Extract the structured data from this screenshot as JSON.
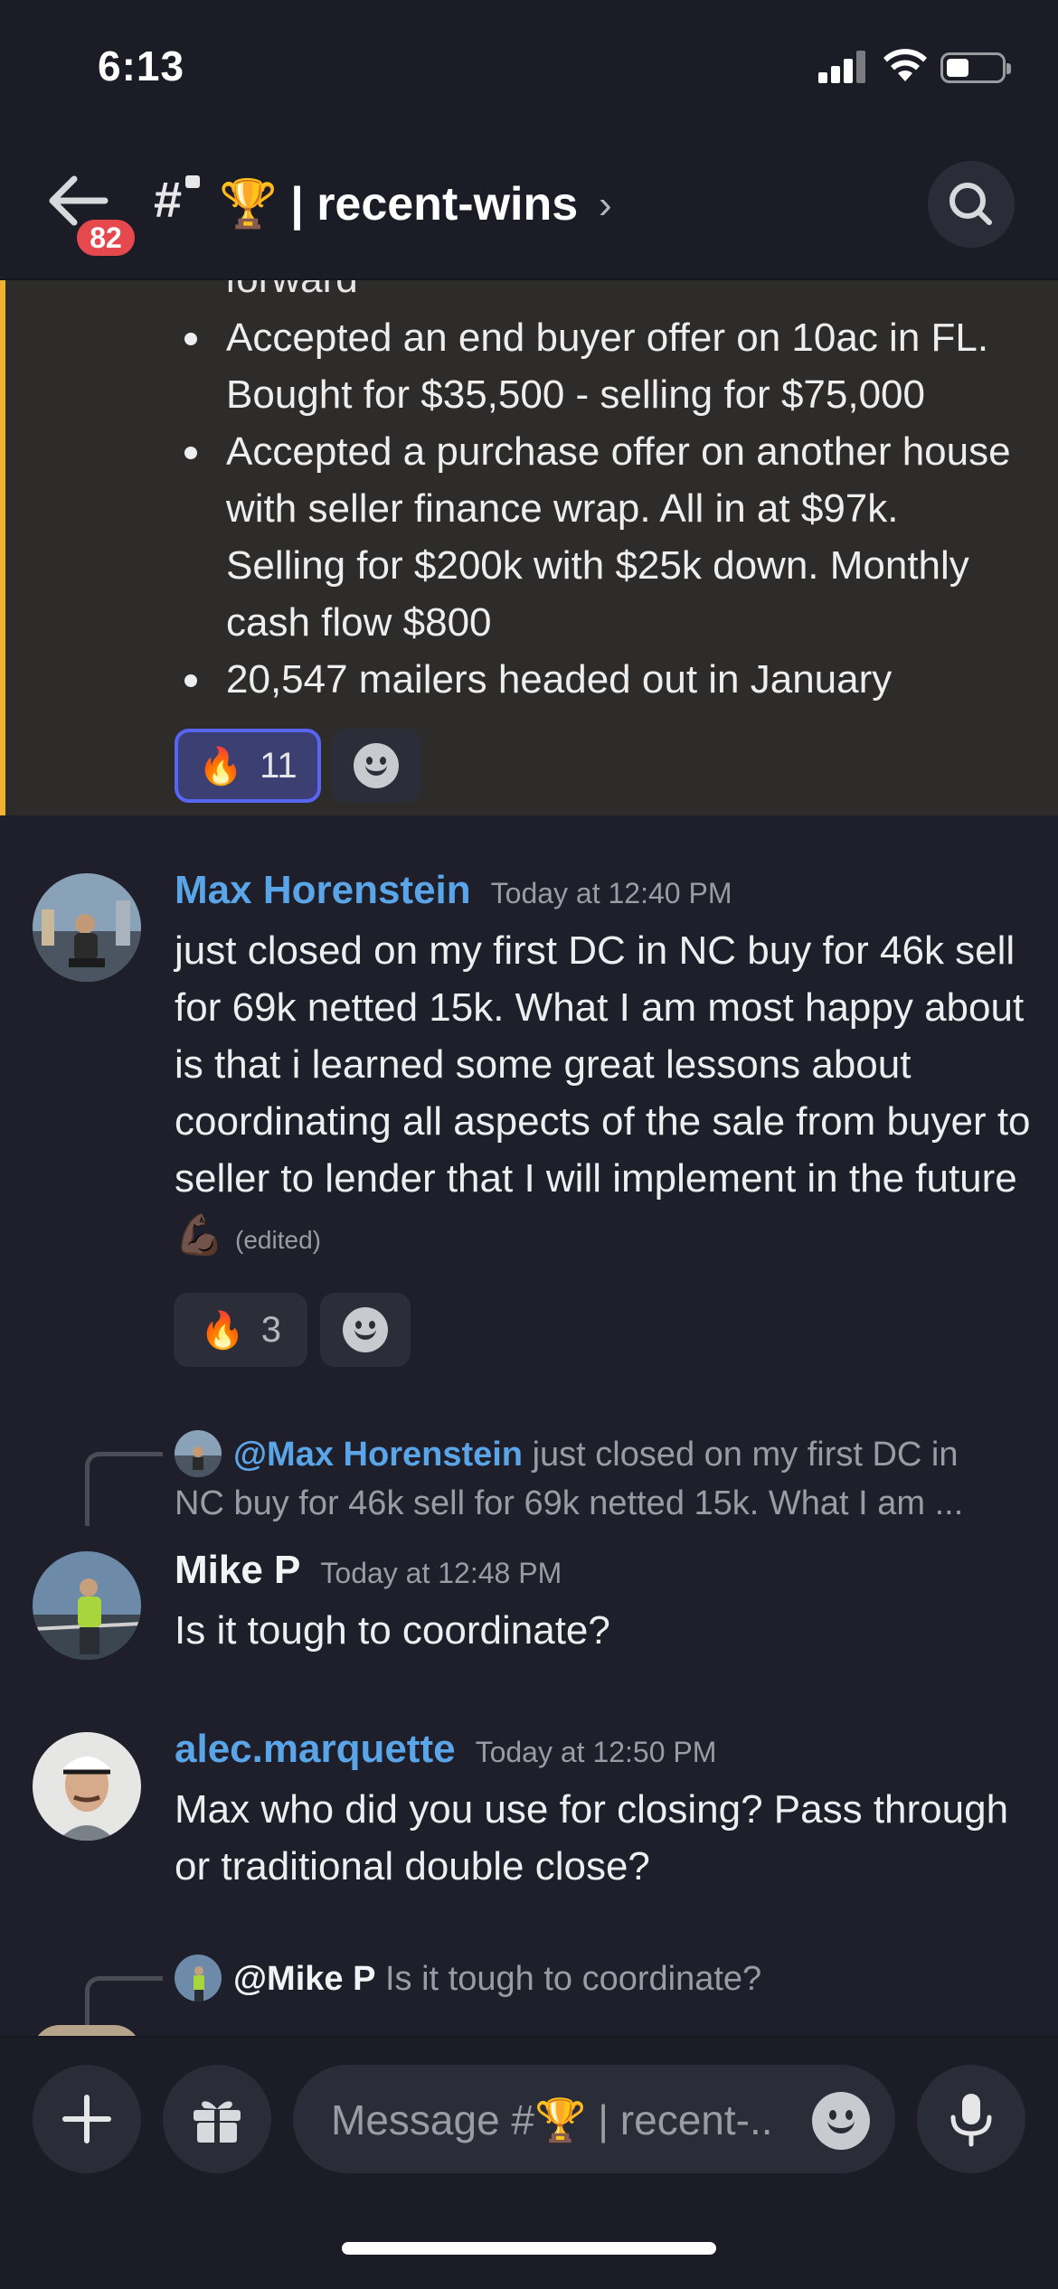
{
  "status_bar": {
    "time": "6:13"
  },
  "header": {
    "unread_badge": "82",
    "channel_prefix": "#",
    "channel_name": "🏆 | recent-wins",
    "chevron": "›"
  },
  "messages": {
    "cut_line": "forward",
    "bullets": [
      "Accepted an end buyer offer on 10ac in FL. Bought for $35,500 - selling for $75,000",
      "Accepted a purchase offer on another house with seller finance wrap.  All in at $97k.  Selling for $200k with $25k down.  Monthly cash flow $800",
      "20,547 mailers headed out in January"
    ],
    "highlight_reaction": {
      "emoji": "🔥",
      "count": "11"
    },
    "max_message": {
      "author": "Max Horenstein",
      "timestamp": "Today at 12:40 PM",
      "text": "just closed on my first DC in NC buy for 46k sell for 69k netted 15k. What I am most happy about is that i learned some great lessons about coordinating all aspects of the sale from buyer to seller to lender that I will implement in the future",
      "emoji_inline": "💪🏿",
      "edited": "(edited)",
      "reaction": {
        "emoji": "🔥",
        "count": "3"
      }
    },
    "reply1": {
      "mention": "@Max Horenstein",
      "preview_line1": "just closed on my first DC in",
      "preview_line2": "NC buy for 46k sell for 69k netted 15k. What I am ..."
    },
    "mike_message": {
      "author": "Mike P",
      "timestamp": "Today at 12:48 PM",
      "text": "Is it tough to coordinate?"
    },
    "alec_message": {
      "author": "alec.marquette",
      "timestamp": "Today at 12:50 PM",
      "text": "Max who did you use for closing? Pass through or traditional double close?"
    },
    "reply2": {
      "mention": "@Mike P",
      "preview": "Is it tough to coordinate?"
    }
  },
  "composer": {
    "placeholder": "Message #🏆 | recent-.."
  },
  "icons": {
    "back": "arrow-left-icon",
    "search": "search-icon",
    "plus": "plus-icon",
    "gift": "gift-icon",
    "emoji": "smile-icon",
    "mic": "microphone-icon"
  },
  "colors": {
    "background": "#1e1f2a",
    "highlight_bg": "#2e2c2a",
    "highlight_bar": "#f0b232",
    "link_name": "#5aa5e8",
    "badge": "#e5484d",
    "reaction_active": "#5865f2"
  }
}
